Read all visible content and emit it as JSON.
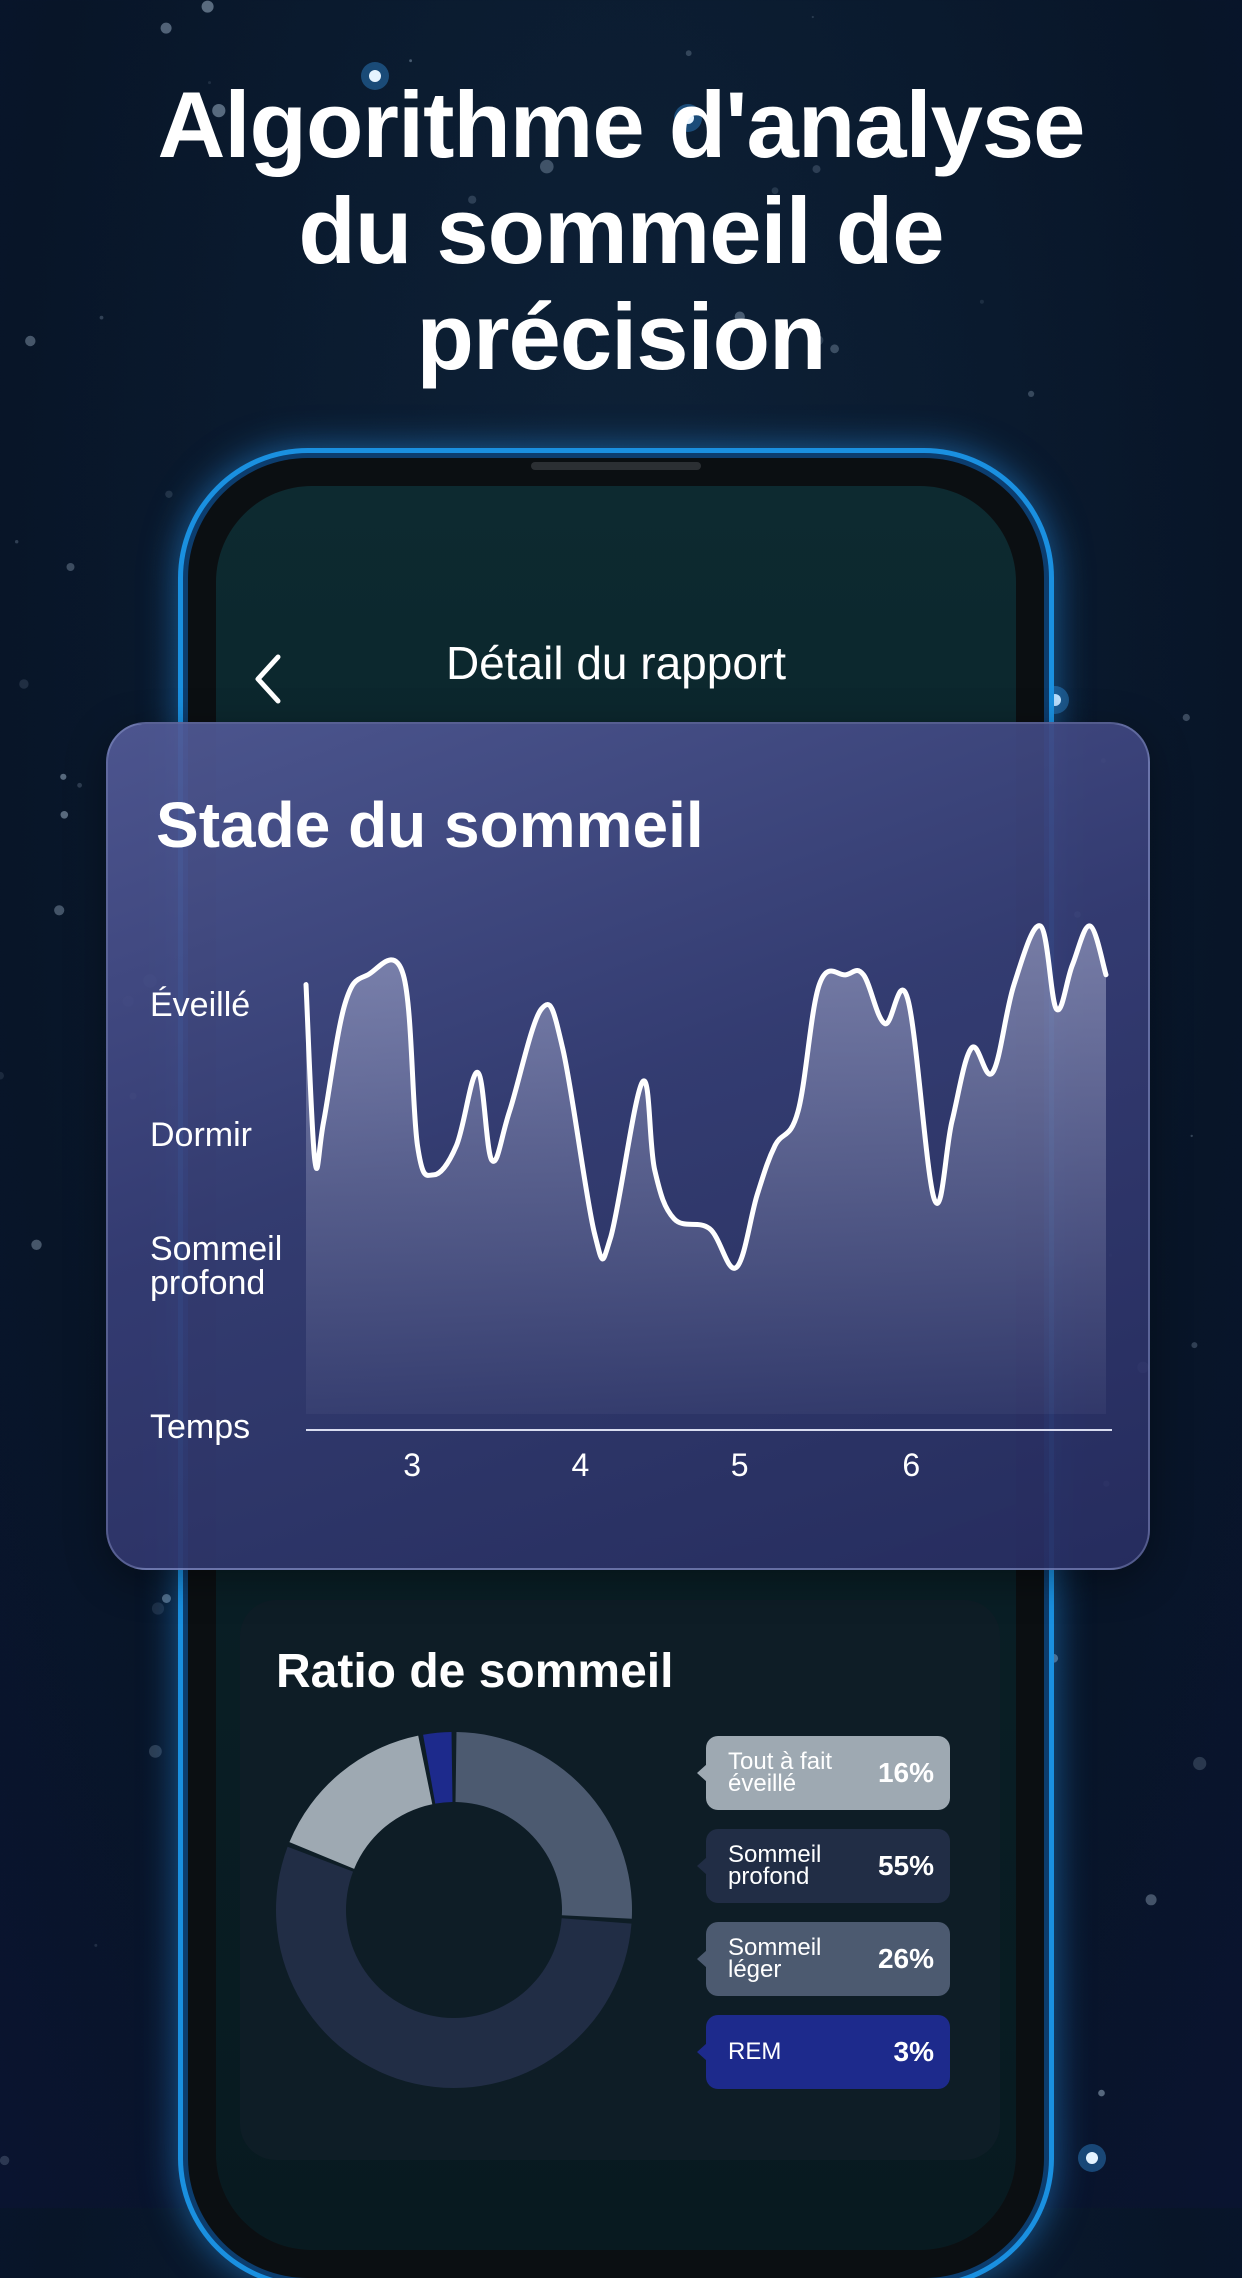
{
  "headline": [
    "Algorithme d'analyse",
    "du sommeil de",
    "précision"
  ],
  "nav": {
    "title": "Détail du rapport"
  },
  "stage_card": {
    "title": "Stade du sommeil",
    "y_labels": [
      "Éveillé",
      "Dormir",
      "Sommeil profond",
      "Temps"
    ]
  },
  "ratio_card": {
    "title": "Ratio de sommeil",
    "items": [
      {
        "label": "Tout à fait éveillé",
        "percent": "16%",
        "color": "#9ea9b2"
      },
      {
        "label": "Sommeil profond",
        "percent": "55%",
        "color": "#212d45"
      },
      {
        "label": "Sommeil léger",
        "percent": "26%",
        "color": "#4c5a70"
      },
      {
        "label": "REM",
        "percent": "3%",
        "color": "#1d2a8c"
      }
    ]
  },
  "chart_data": {
    "type": "area",
    "title": "Stade du sommeil",
    "xlabel": "Temps",
    "ylabel": "",
    "x_ticks": [
      "3",
      "4",
      "5",
      "6"
    ],
    "y_categories": [
      "Sommeil profond",
      "Dormir",
      "Éveillé"
    ],
    "series": [
      {
        "x": [
          2.4,
          2.45,
          2.5,
          2.62,
          2.75,
          2.95,
          3.03,
          3.12,
          3.25,
          3.37,
          3.45,
          3.55,
          3.73,
          3.85,
          4.03,
          4.12,
          4.3,
          4.37,
          4.48,
          4.68,
          4.83,
          4.95,
          5.05,
          5.18,
          5.3,
          5.45,
          5.55,
          5.67,
          5.8,
          5.95,
          6.05,
          6.16,
          6.28,
          6.4,
          6.55,
          6.64,
          6.73,
          6.83,
          6.92
        ],
        "y": [
          0.88,
          0.52,
          0.6,
          0.84,
          0.9,
          0.9,
          0.55,
          0.49,
          0.55,
          0.7,
          0.52,
          0.62,
          0.83,
          0.75,
          0.37,
          0.36,
          0.68,
          0.5,
          0.4,
          0.38,
          0.3,
          0.45,
          0.55,
          0.62,
          0.88,
          0.9,
          0.9,
          0.8,
          0.85,
          0.44,
          0.6,
          0.75,
          0.7,
          0.88,
          1.0,
          0.83,
          0.92,
          1.0,
          0.9
        ]
      }
    ]
  }
}
